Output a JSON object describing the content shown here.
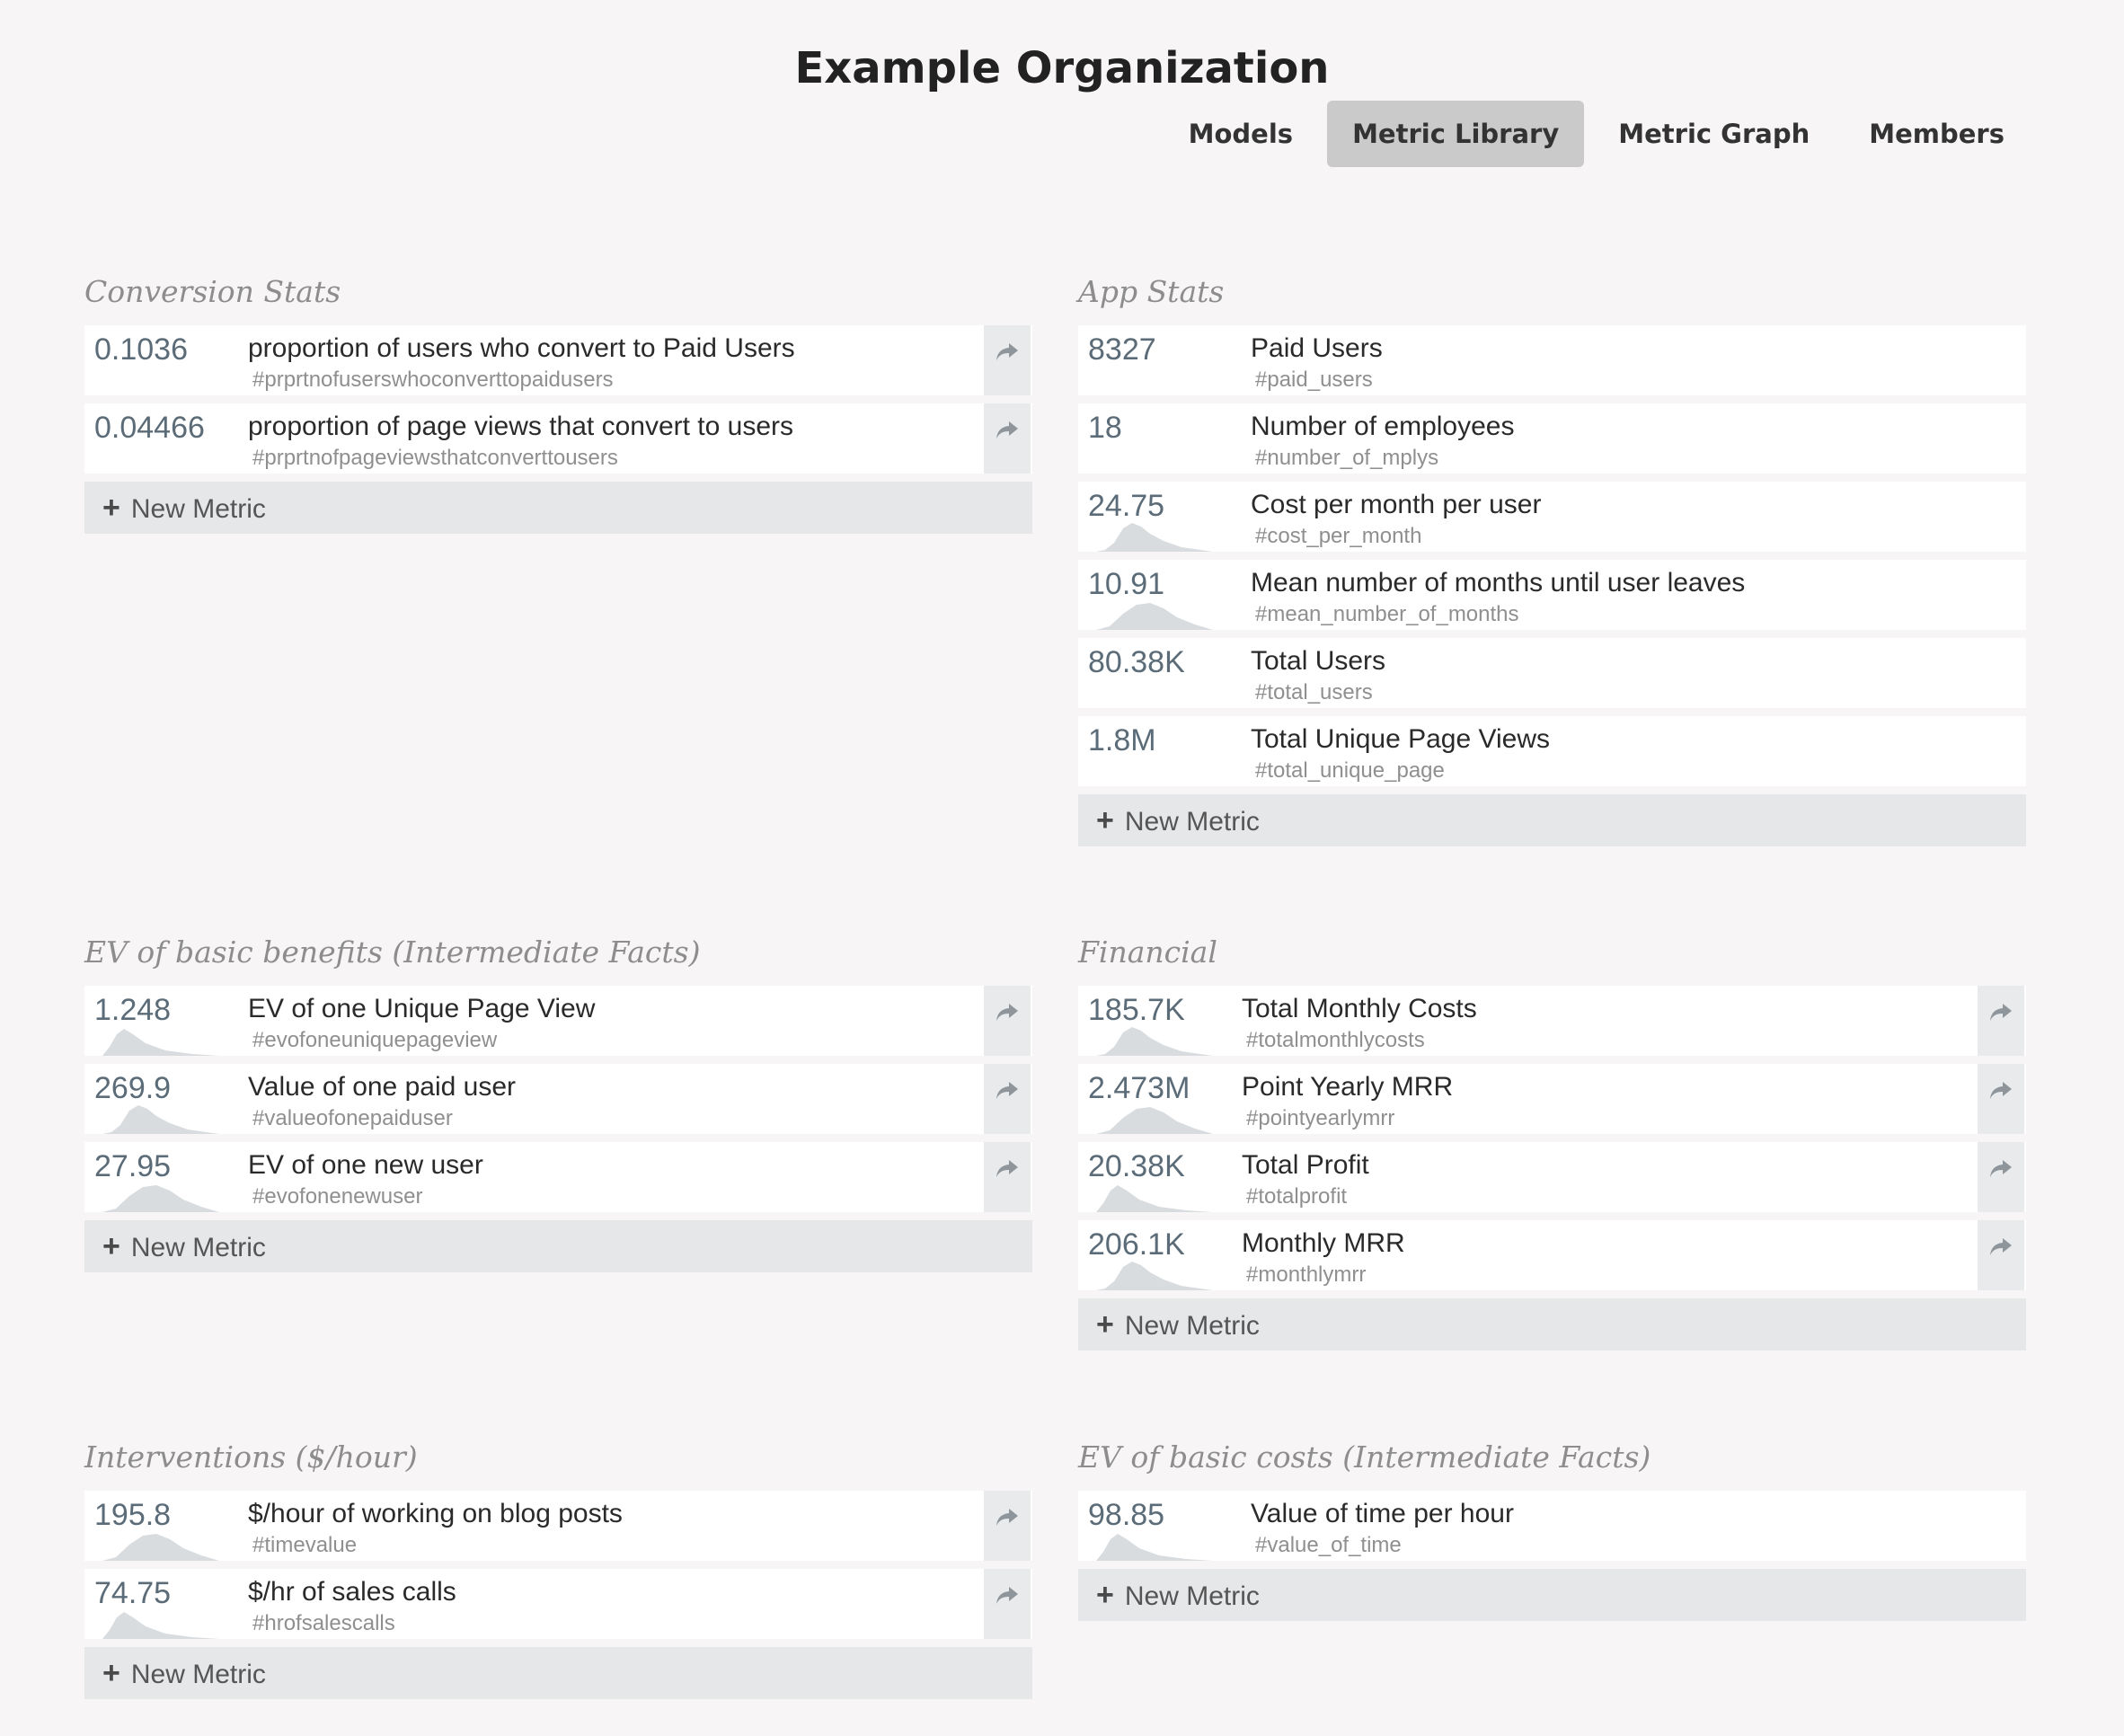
{
  "org_title": "Example Organization",
  "nav": {
    "tabs": [
      {
        "label": "Models"
      },
      {
        "label": "Metric Library",
        "active": true
      },
      {
        "label": "Metric Graph"
      },
      {
        "label": "Members"
      }
    ]
  },
  "new_metric_label": "New Metric",
  "sections": [
    {
      "title": "Conversion Stats",
      "metrics": [
        {
          "value": "0.1036",
          "label": "proportion of users who convert to Paid Users",
          "id": "#prprtnofuserswhoconverttopaidusers"
        },
        {
          "value": "0.04466",
          "label": "proportion of page views that convert to users",
          "id": "#prprtnofpageviewsthatconverttousers"
        }
      ]
    },
    {
      "title": "App Stats",
      "metrics": [
        {
          "value": "8327",
          "label": "Paid Users",
          "id": "#paid_users"
        },
        {
          "value": "18",
          "label": "Number of employees",
          "id": "#number_of_mplys"
        },
        {
          "value": "24.75",
          "label": "Cost per month per user",
          "id": "#cost_per_month"
        },
        {
          "value": "10.91",
          "label": "Mean number of months until user leaves",
          "id": "#mean_number_of_months"
        },
        {
          "value": "80.38K",
          "label": "Total Users",
          "id": "#total_users"
        },
        {
          "value": "1.8M",
          "label": "Total Unique Page Views",
          "id": "#total_unique_page"
        }
      ]
    },
    {
      "title": "EV of basic benefits (Intermediate Facts)",
      "metrics": [
        {
          "value": "1.248",
          "label": "EV of one Unique Page View",
          "id": "#evofoneuniquepageview"
        },
        {
          "value": "269.9",
          "label": "Value of one paid user",
          "id": "#valueofonepaiduser"
        },
        {
          "value": "27.95",
          "label": "EV of one new user",
          "id": "#evofonenewuser"
        }
      ]
    },
    {
      "title": "Financial",
      "metrics": [
        {
          "value": "185.7K",
          "label": "Total Monthly Costs",
          "id": "#totalmonthlycosts"
        },
        {
          "value": "2.473M",
          "label": "Point Yearly MRR",
          "id": "#pointyearlymrr"
        },
        {
          "value": "20.38K",
          "label": "Total Profit",
          "id": "#totalprofit"
        },
        {
          "value": "206.1K",
          "label": "Monthly MRR",
          "id": "#monthlymrr"
        }
      ]
    },
    {
      "title": "Interventions ($/hour)",
      "metrics": [
        {
          "value": "195.8",
          "label": "$/hour of working on blog posts",
          "id": "#timevalue"
        },
        {
          "value": "74.75",
          "label": "$/hr of sales calls",
          "id": "#hrofsalescalls"
        }
      ]
    },
    {
      "title": "EV of basic costs (Intermediate Facts)",
      "metrics": [
        {
          "value": "98.85",
          "label": "Value of time per hour",
          "id": "#value_of_time"
        }
      ]
    }
  ],
  "colors": {
    "background": "#f7f5f5",
    "value_text": "#5b6c78",
    "active_tab": "#cacaca",
    "new_metric_bg": "#e6e7e9",
    "sparkline": "#d9dcdf"
  },
  "icons": {
    "share": "share-arrow-icon",
    "plus": "plus-icon"
  }
}
